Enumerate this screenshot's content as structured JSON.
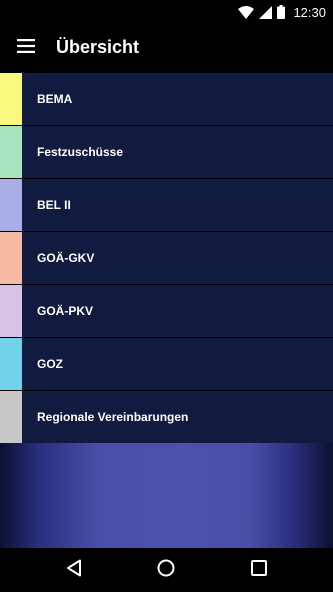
{
  "status_bar": {
    "time": "12:30",
    "icons": [
      "wifi-icon",
      "signal-icon",
      "battery-icon"
    ]
  },
  "app_bar": {
    "menu_icon": "menu-icon",
    "title": "Übersicht"
  },
  "list": {
    "items": [
      {
        "label": "BEMA",
        "color": "#faf97f"
      },
      {
        "label": "Festzuschüsse",
        "color": "#a8e3c0"
      },
      {
        "label": "BEL II",
        "color": "#a9aee6"
      },
      {
        "label": "GOÄ-GKV",
        "color": "#f6b9a4"
      },
      {
        "label": "GOÄ-PKV",
        "color": "#d8c2e6"
      },
      {
        "label": "GOZ",
        "color": "#71d2ea"
      },
      {
        "label": "Regionale Vereinbarungen",
        "color": "#c8c8c8"
      }
    ]
  },
  "colors": {
    "list_background": "#111a3f",
    "accent_background": "#4d52ab"
  },
  "nav_bar": {
    "icons": [
      "back-icon",
      "home-icon",
      "recents-icon"
    ]
  }
}
